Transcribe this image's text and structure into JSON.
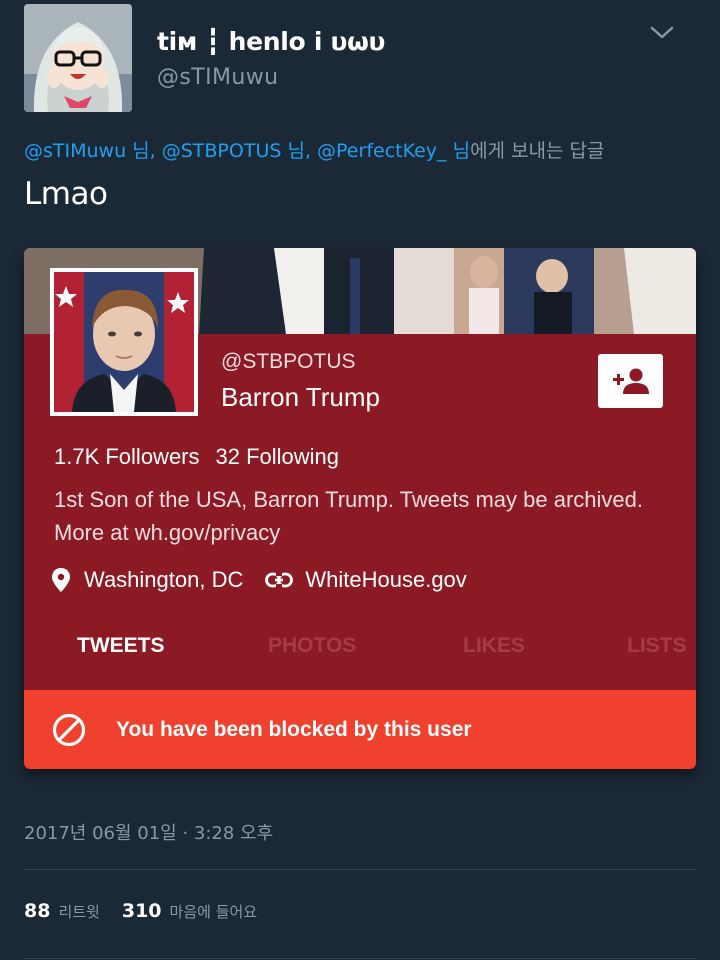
{
  "tweet": {
    "author": {
      "display_name": "tiм ┇ henlo i υωυ",
      "handle": "@sTIMuwu",
      "avatar_icon": "anime-avatar"
    },
    "menu_icon": "chevron-down-icon",
    "reply_context": {
      "mentions": [
        {
          "handle": "@sTIMuwu",
          "suffix": " 님, "
        },
        {
          "handle": "@STBPOTUS",
          "suffix": " 님, "
        },
        {
          "handle": "@PerfectKey_",
          "suffix": " 님"
        }
      ],
      "tail": "에게 보내는 답글"
    },
    "text": "Lmao",
    "timestamp": "2017년 06월 01일 · 3:28 오후",
    "retweets": {
      "count": "88",
      "label": "리트윗"
    },
    "likes": {
      "count": "310",
      "label": "마음에 들어요"
    }
  },
  "profile_card": {
    "handle": "@STBPOTUS",
    "name": "Barron Trump",
    "followers": "1.7K Followers",
    "following": "32 Following",
    "bio": "1st Son of the USA, Barron Trump. Tweets may be archived. More at wh.gov/privacy",
    "location": "Washington, DC",
    "website": "WhiteHouse.gov",
    "tabs": [
      "TWEETS",
      "PHOTOS",
      "LIKES",
      "LISTS"
    ],
    "active_tab": "TWEETS",
    "blocked_message": "You have been blocked by this user",
    "colors": {
      "card_background": "#8b1a24",
      "blocked_bar": "#f0412f",
      "inactive_tab": "#a83a45"
    }
  },
  "colors": {
    "background": "#1b2836",
    "mention": "#1da1f2",
    "secondary_text": "#8899a6"
  }
}
